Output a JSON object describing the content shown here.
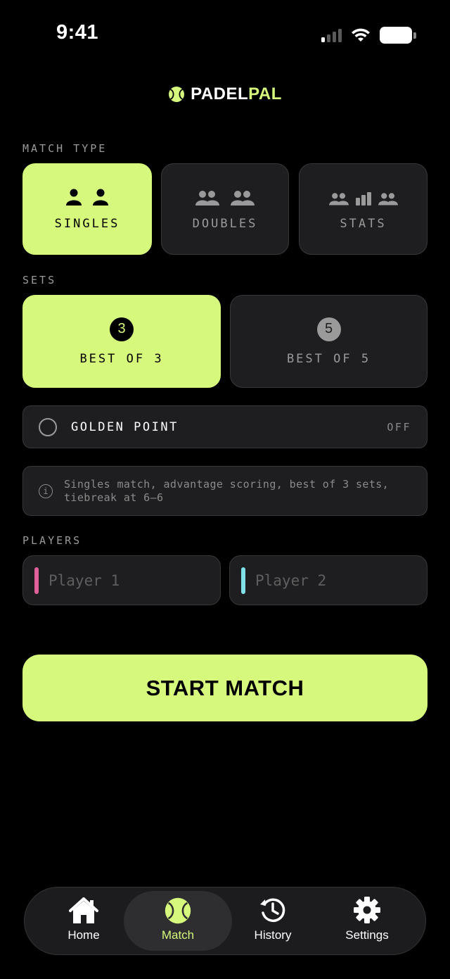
{
  "status_bar": {
    "time": "9:41"
  },
  "brand": {
    "part1": "PADEL",
    "part2": "PAL",
    "logo_icon": "tennis-ball-icon",
    "accent_color": "#d6f87d"
  },
  "match_type": {
    "label": "MATCH TYPE",
    "options": [
      {
        "label": "SINGLES",
        "icon": "singles-icon",
        "selected": true
      },
      {
        "label": "DOUBLES",
        "icon": "doubles-icon",
        "selected": false
      },
      {
        "label": "STATS",
        "icon": "stats-icon",
        "selected": false
      }
    ]
  },
  "sets": {
    "label": "SETS",
    "options": [
      {
        "number": "3",
        "label": "BEST OF 3",
        "selected": true
      },
      {
        "number": "5",
        "label": "BEST OF 5",
        "selected": false
      }
    ]
  },
  "golden_point": {
    "label": "GOLDEN POINT",
    "state": "OFF"
  },
  "info": {
    "icon": "info-icon",
    "line1": "Singles match, advantage scoring, best of 3 sets,",
    "line2": "tiebreak at 6–6"
  },
  "players": {
    "label": "PLAYERS",
    "fields": [
      {
        "placeholder": "Player 1",
        "value": "",
        "color": "#e0609a"
      },
      {
        "placeholder": "Player 2",
        "value": "",
        "color": "#7fe0e8"
      }
    ]
  },
  "start_button": {
    "label": "START MATCH"
  },
  "tab_bar": {
    "items": [
      {
        "label": "Home",
        "icon": "home-icon",
        "active": false
      },
      {
        "label": "Match",
        "icon": "tennis-ball-icon",
        "active": true
      },
      {
        "label": "History",
        "icon": "history-icon",
        "active": false
      },
      {
        "label": "Settings",
        "icon": "gear-icon",
        "active": false
      }
    ]
  }
}
